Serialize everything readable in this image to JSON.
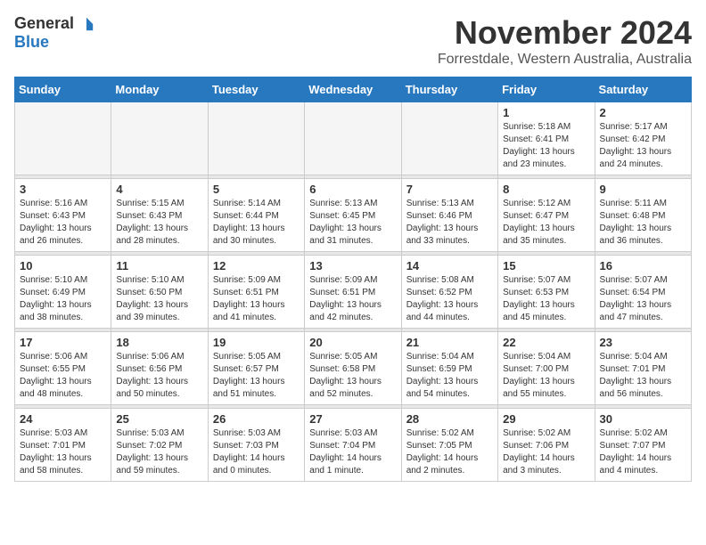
{
  "header": {
    "logo_general": "General",
    "logo_blue": "Blue",
    "month": "November 2024",
    "location": "Forrestdale, Western Australia, Australia"
  },
  "days_of_week": [
    "Sunday",
    "Monday",
    "Tuesday",
    "Wednesday",
    "Thursday",
    "Friday",
    "Saturday"
  ],
  "weeks": [
    {
      "days": [
        {
          "num": "",
          "info": ""
        },
        {
          "num": "",
          "info": ""
        },
        {
          "num": "",
          "info": ""
        },
        {
          "num": "",
          "info": ""
        },
        {
          "num": "",
          "info": ""
        },
        {
          "num": "1",
          "info": "Sunrise: 5:18 AM\nSunset: 6:41 PM\nDaylight: 13 hours\nand 23 minutes."
        },
        {
          "num": "2",
          "info": "Sunrise: 5:17 AM\nSunset: 6:42 PM\nDaylight: 13 hours\nand 24 minutes."
        }
      ]
    },
    {
      "days": [
        {
          "num": "3",
          "info": "Sunrise: 5:16 AM\nSunset: 6:43 PM\nDaylight: 13 hours\nand 26 minutes."
        },
        {
          "num": "4",
          "info": "Sunrise: 5:15 AM\nSunset: 6:43 PM\nDaylight: 13 hours\nand 28 minutes."
        },
        {
          "num": "5",
          "info": "Sunrise: 5:14 AM\nSunset: 6:44 PM\nDaylight: 13 hours\nand 30 minutes."
        },
        {
          "num": "6",
          "info": "Sunrise: 5:13 AM\nSunset: 6:45 PM\nDaylight: 13 hours\nand 31 minutes."
        },
        {
          "num": "7",
          "info": "Sunrise: 5:13 AM\nSunset: 6:46 PM\nDaylight: 13 hours\nand 33 minutes."
        },
        {
          "num": "8",
          "info": "Sunrise: 5:12 AM\nSunset: 6:47 PM\nDaylight: 13 hours\nand 35 minutes."
        },
        {
          "num": "9",
          "info": "Sunrise: 5:11 AM\nSunset: 6:48 PM\nDaylight: 13 hours\nand 36 minutes."
        }
      ]
    },
    {
      "days": [
        {
          "num": "10",
          "info": "Sunrise: 5:10 AM\nSunset: 6:49 PM\nDaylight: 13 hours\nand 38 minutes."
        },
        {
          "num": "11",
          "info": "Sunrise: 5:10 AM\nSunset: 6:50 PM\nDaylight: 13 hours\nand 39 minutes."
        },
        {
          "num": "12",
          "info": "Sunrise: 5:09 AM\nSunset: 6:51 PM\nDaylight: 13 hours\nand 41 minutes."
        },
        {
          "num": "13",
          "info": "Sunrise: 5:09 AM\nSunset: 6:51 PM\nDaylight: 13 hours\nand 42 minutes."
        },
        {
          "num": "14",
          "info": "Sunrise: 5:08 AM\nSunset: 6:52 PM\nDaylight: 13 hours\nand 44 minutes."
        },
        {
          "num": "15",
          "info": "Sunrise: 5:07 AM\nSunset: 6:53 PM\nDaylight: 13 hours\nand 45 minutes."
        },
        {
          "num": "16",
          "info": "Sunrise: 5:07 AM\nSunset: 6:54 PM\nDaylight: 13 hours\nand 47 minutes."
        }
      ]
    },
    {
      "days": [
        {
          "num": "17",
          "info": "Sunrise: 5:06 AM\nSunset: 6:55 PM\nDaylight: 13 hours\nand 48 minutes."
        },
        {
          "num": "18",
          "info": "Sunrise: 5:06 AM\nSunset: 6:56 PM\nDaylight: 13 hours\nand 50 minutes."
        },
        {
          "num": "19",
          "info": "Sunrise: 5:05 AM\nSunset: 6:57 PM\nDaylight: 13 hours\nand 51 minutes."
        },
        {
          "num": "20",
          "info": "Sunrise: 5:05 AM\nSunset: 6:58 PM\nDaylight: 13 hours\nand 52 minutes."
        },
        {
          "num": "21",
          "info": "Sunrise: 5:04 AM\nSunset: 6:59 PM\nDaylight: 13 hours\nand 54 minutes."
        },
        {
          "num": "22",
          "info": "Sunrise: 5:04 AM\nSunset: 7:00 PM\nDaylight: 13 hours\nand 55 minutes."
        },
        {
          "num": "23",
          "info": "Sunrise: 5:04 AM\nSunset: 7:01 PM\nDaylight: 13 hours\nand 56 minutes."
        }
      ]
    },
    {
      "days": [
        {
          "num": "24",
          "info": "Sunrise: 5:03 AM\nSunset: 7:01 PM\nDaylight: 13 hours\nand 58 minutes."
        },
        {
          "num": "25",
          "info": "Sunrise: 5:03 AM\nSunset: 7:02 PM\nDaylight: 13 hours\nand 59 minutes."
        },
        {
          "num": "26",
          "info": "Sunrise: 5:03 AM\nSunset: 7:03 PM\nDaylight: 14 hours\nand 0 minutes."
        },
        {
          "num": "27",
          "info": "Sunrise: 5:03 AM\nSunset: 7:04 PM\nDaylight: 14 hours\nand 1 minute."
        },
        {
          "num": "28",
          "info": "Sunrise: 5:02 AM\nSunset: 7:05 PM\nDaylight: 14 hours\nand 2 minutes."
        },
        {
          "num": "29",
          "info": "Sunrise: 5:02 AM\nSunset: 7:06 PM\nDaylight: 14 hours\nand 3 minutes."
        },
        {
          "num": "30",
          "info": "Sunrise: 5:02 AM\nSunset: 7:07 PM\nDaylight: 14 hours\nand 4 minutes."
        }
      ]
    }
  ]
}
